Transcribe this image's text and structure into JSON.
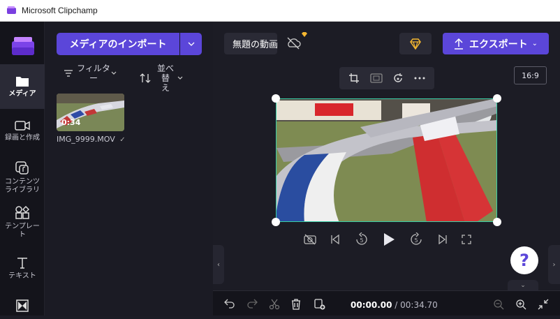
{
  "window": {
    "title": "Microsoft Clipchamp"
  },
  "rail": {
    "items": [
      {
        "label": "メディア",
        "icon": "folder-icon"
      },
      {
        "label": "録画と作成",
        "icon": "video-camera-icon"
      },
      {
        "label": "コンテンツ\nライブラリ",
        "icon": "content-library-icon"
      },
      {
        "label": "テンプレー\nト",
        "icon": "templates-icon"
      },
      {
        "label": "テキスト",
        "icon": "text-icon"
      },
      {
        "label": "",
        "icon": "transitions-icon"
      }
    ]
  },
  "media_panel": {
    "import_label": "メディアのインポート",
    "filter_label": "フィルタ\nー",
    "sort_label": "並べ替\nえ",
    "items": [
      {
        "filename": "IMG_9999.MOV",
        "duration": "0:34"
      }
    ]
  },
  "header": {
    "project_name": "無題の動画",
    "export_label": "エクスポート"
  },
  "preview": {
    "aspect_ratio": "16:9"
  },
  "timeline": {
    "current_time": "00:00.00",
    "separator": " / ",
    "total_time": "00:34.70"
  },
  "help": {
    "label": "?"
  },
  "colors": {
    "accent": "#5b46d9",
    "selection": "#39d0a8",
    "premium": "#f5b731"
  }
}
